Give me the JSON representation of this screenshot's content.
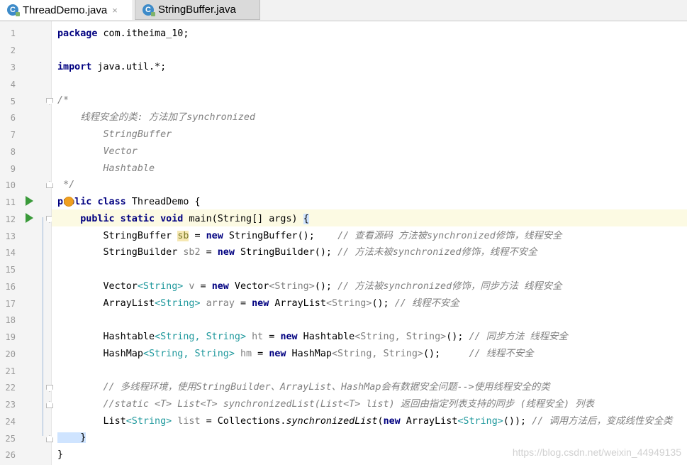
{
  "tabs": [
    {
      "label": "ThreadDemo.java",
      "icon": "java-class-icon",
      "active": true
    },
    {
      "label": "StringBuffer.java",
      "icon": "java-class-icon",
      "active": false
    }
  ],
  "close_glyph": "×",
  "lines": [
    "1",
    "2",
    "3",
    "4",
    "5",
    "6",
    "7",
    "8",
    "9",
    "10",
    "11",
    "12",
    "13",
    "14",
    "15",
    "16",
    "17",
    "18",
    "19",
    "20",
    "21",
    "22",
    "23",
    "24",
    "25",
    "26"
  ],
  "code": {
    "package_kw": "package",
    "package_name": " com.itheima_10;",
    "import_kw": "import",
    "import_name": " java.util.*;",
    "l5": "/*",
    "l6": "    线程安全的类: 方法加了synchronized",
    "l7": "        StringBuffer",
    "l8": "        Vector",
    "l9": "        Hashtable",
    "l10": " */",
    "l11_kw1": "public",
    "l11_kw2": "class",
    "l11_rest": " ThreadDemo {",
    "l12_kw": "public static void",
    "l12_rest": " main(String[] args) ",
    "l12_brace": "{",
    "l13_a": "        StringBuffer ",
    "l13_var": "sb",
    "l13_b": " = ",
    "l13_new": "new",
    "l13_c": " StringBuffer();    ",
    "l13_cm": "// 查看源码 方法被synchronized修饰，线程安全",
    "l14_a": "        StringBuilder ",
    "l14_var": "sb2",
    "l14_b": " = ",
    "l14_new": "new",
    "l14_c": " StringBuilder(); ",
    "l14_cm": "// 方法未被synchronized修饰，线程不安全",
    "l16_a": "        Vector",
    "l16_g1": "<String>",
    "l16_var": " v",
    "l16_b": " = ",
    "l16_new": "new",
    "l16_c": " Vector",
    "l16_g2": "<String>",
    "l16_d": "(); ",
    "l16_cm": "// 方法被synchronized修饰，同步方法 线程安全",
    "l17_a": "        ArrayList",
    "l17_g1": "<String>",
    "l17_var": " array",
    "l17_b": " = ",
    "l17_new": "new",
    "l17_c": " ArrayList",
    "l17_g2": "<String>",
    "l17_d": "(); ",
    "l17_cm": "// 线程不安全",
    "l19_a": "        Hashtable",
    "l19_g1": "<String, String>",
    "l19_var": " ht",
    "l19_b": " = ",
    "l19_new": "new",
    "l19_c": " Hashtable",
    "l19_g2": "<String, String>",
    "l19_d": "(); ",
    "l19_cm": "// 同步方法 线程安全",
    "l20_a": "        HashMap",
    "l20_g1": "<String, String>",
    "l20_var": " hm",
    "l20_b": " = ",
    "l20_new": "new",
    "l20_c": " HashMap",
    "l20_g2": "<String, String>",
    "l20_d": "();     ",
    "l20_cm": "// 线程不安全",
    "l22": "        // 多线程环境，使用StringBuilder、ArrayList、HashMap会有数据安全问题-->使用线程安全的类",
    "l23": "        //static <T> List<T> synchronizedList(List<T> list) 返回由指定列表支持的同步 (线程安全) 列表",
    "l24_a": "        List",
    "l24_g1": "<String>",
    "l24_var": " list",
    "l24_b": " = Collections.",
    "l24_st": "synchronizedList",
    "l24_c": "(",
    "l24_new": "new",
    "l24_d": " ArrayList",
    "l24_g2": "<String>",
    "l24_e": "()); ",
    "l24_cm": "// 调用方法后，变成线性安全类",
    "l25": "    }",
    "l26": "}"
  },
  "watermark": "https://blog.csdn.net/weixin_44949135"
}
